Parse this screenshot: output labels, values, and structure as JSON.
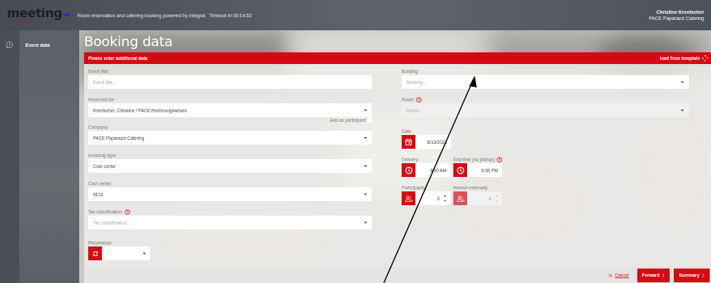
{
  "header": {
    "logo": "meeting",
    "subtitle": "Room reservation and catering booking powered by Integral",
    "timeout": "Timeout in 00:14:52",
    "user": {
      "name": "Christine Krentscher",
      "company": "PACE Paparazzi Catering"
    }
  },
  "sidebar": {
    "items": [
      {
        "label": "Event data",
        "selected": true
      }
    ]
  },
  "page_title": "Booking data",
  "banner": {
    "message": "Please enter additional data",
    "action": "load from template"
  },
  "left_fields": [
    {
      "kind": "text",
      "label": "Event title:",
      "placeholder": "Event title...",
      "help": false,
      "disabled": false
    },
    {
      "kind": "select",
      "label": "Reserved for:",
      "value": "Krentscher, Christine / PACE  Rechnungswesen",
      "help": false,
      "disabled": false,
      "option": {
        "label": "Add as participant",
        "checked": false
      }
    },
    {
      "kind": "select",
      "label": "Company:",
      "value": "PACE Paparazzi Catering",
      "help": false,
      "disabled": false
    },
    {
      "kind": "select",
      "label": "Invoicing type:",
      "value": "Cost center",
      "help": false,
      "disabled": false
    },
    {
      "kind": "select",
      "label": "Cost center:",
      "value": "0613",
      "help": false,
      "disabled": false
    },
    {
      "kind": "select",
      "label": "Tax classification:",
      "placeholder": "Tax classification...",
      "help": true,
      "disabled": false
    },
    {
      "kind": "recurrence",
      "label": "Recurrence:"
    }
  ],
  "right_fields": [
    {
      "kind": "select",
      "label": "Building:",
      "placeholder": "Building...",
      "help": false,
      "disabled": false
    },
    {
      "kind": "select",
      "label": "Room:",
      "placeholder": "Room...",
      "help": true,
      "disabled": true
    },
    {
      "kind": "date",
      "label": "Date:",
      "value": "8/13/2021"
    },
    {
      "kind": "time_pair",
      "items": [
        {
          "label": "Delivery:",
          "value": "9:00 AM",
          "help": false
        },
        {
          "label": "End time (no pickup):",
          "value": "6:00 PM",
          "help": true
        }
      ]
    },
    {
      "kind": "number_pair",
      "items": [
        {
          "label": "Participants",
          "value": "0",
          "disabled": false
        },
        {
          "label": "thereof externally",
          "value": "0",
          "disabled": true
        }
      ]
    }
  ],
  "footer": {
    "cancel": "Cancel",
    "buttons": [
      "Forward",
      "Summary"
    ]
  }
}
